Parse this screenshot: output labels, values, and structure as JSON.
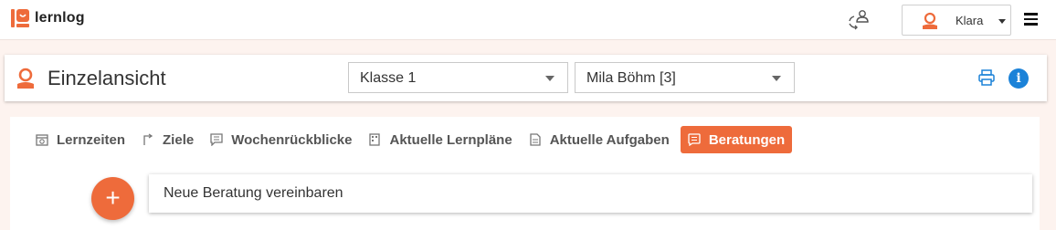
{
  "app": {
    "name": "lernlog",
    "accent": "#ee6b3b",
    "info_color": "#1b82d8"
  },
  "topbar": {
    "sync_icon": "sync-user-icon",
    "user": {
      "name": "Klara",
      "avatar_icon": "user-avatar-icon"
    },
    "menu_icon": "hamburger-icon"
  },
  "header": {
    "title": "Einzelansicht",
    "class_select": {
      "value": "Klasse 1"
    },
    "student_select": {
      "value": "Mila Böhm [3]"
    },
    "print_icon": "print-icon",
    "info_icon": "info-icon",
    "info_glyph": "i"
  },
  "tabs": [
    {
      "label": "Lernzeiten",
      "icon": "calendar-clock-icon",
      "active": false
    },
    {
      "label": "Ziele",
      "icon": "goal-icon",
      "active": false
    },
    {
      "label": "Wochenrückblicke",
      "icon": "comment-icon",
      "active": false
    },
    {
      "label": "Aktuelle Lernpläne",
      "icon": "plan-icon",
      "active": false
    },
    {
      "label": "Aktuelle Aufgaben",
      "icon": "document-icon",
      "active": false
    },
    {
      "label": "Beratungen",
      "icon": "chat-icon",
      "active": true
    }
  ],
  "main": {
    "add_glyph": "+",
    "new_appointment_label": "Neue Beratung vereinbaren"
  }
}
